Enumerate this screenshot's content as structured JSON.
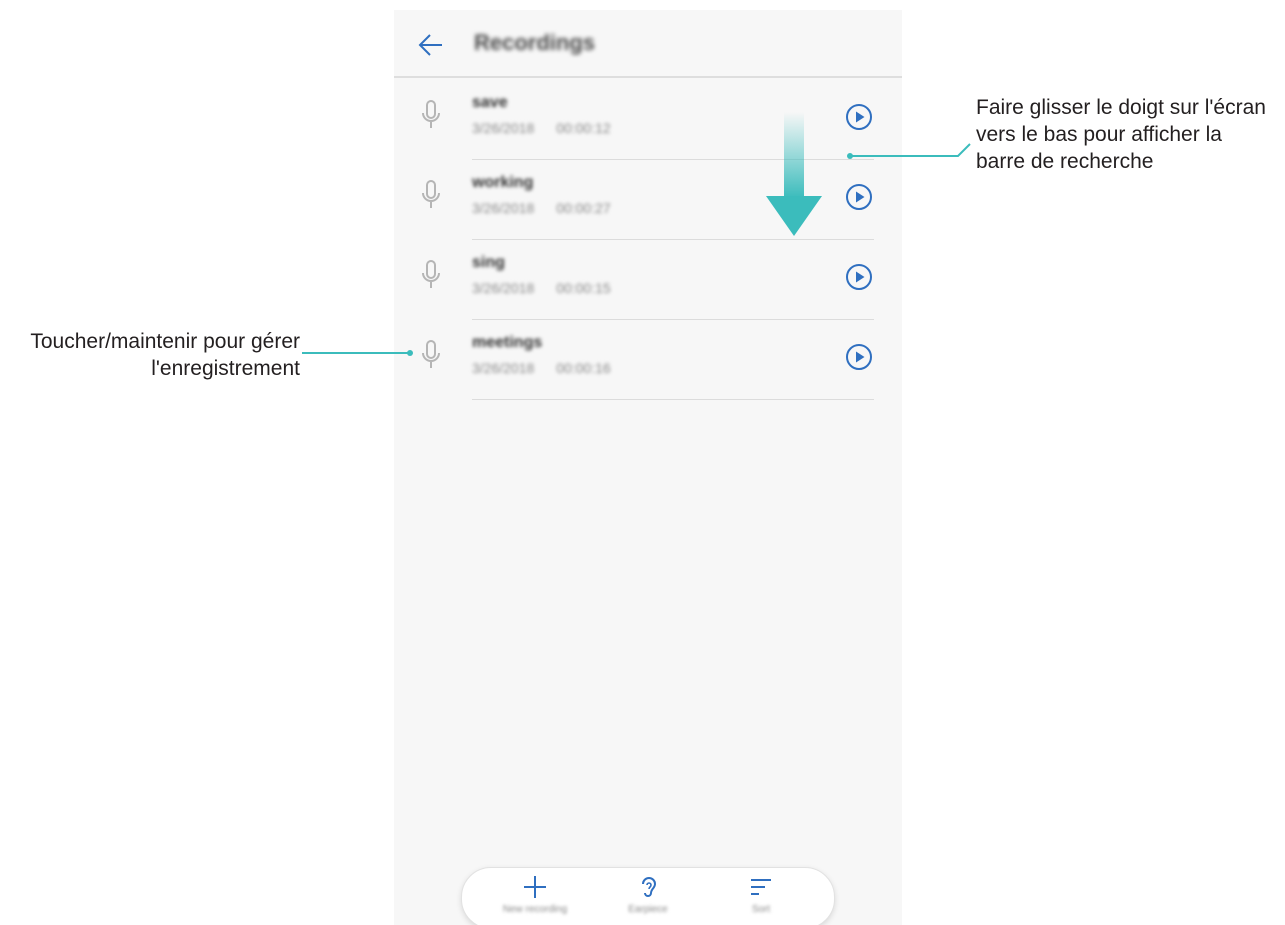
{
  "app": {
    "title": "Recordings"
  },
  "recordings": [
    {
      "name": "save",
      "date": "3/26/2018",
      "duration": "00:00:12"
    },
    {
      "name": "working",
      "date": "3/26/2018",
      "duration": "00:00:27"
    },
    {
      "name": "sing",
      "date": "3/26/2018",
      "duration": "00:00:15"
    },
    {
      "name": "meetings",
      "date": "3/26/2018",
      "duration": "00:00:16"
    }
  ],
  "bottom_bar": {
    "new_recording_label": "New recording",
    "earpiece_label": "Earpiece",
    "sort_label": "Sort"
  },
  "annotations": {
    "swipe_hint": "Faire glisser le doigt sur l'écran vers le bas pour afficher la barre de recherche",
    "hold_hint": "Toucher/maintenir pour gérer l'enregistrement"
  },
  "colors": {
    "accent": "#2f6fc0",
    "annotation_teal": "#3bbcbc",
    "icon_grey": "#b5b5b5"
  },
  "icons": {
    "back": "arrow-left-icon",
    "microphone": "microphone-icon",
    "play": "play-circle-icon",
    "add": "plus-icon",
    "earpiece": "ear-icon",
    "sort": "sort-icon",
    "swipe": "arrow-down-icon"
  }
}
